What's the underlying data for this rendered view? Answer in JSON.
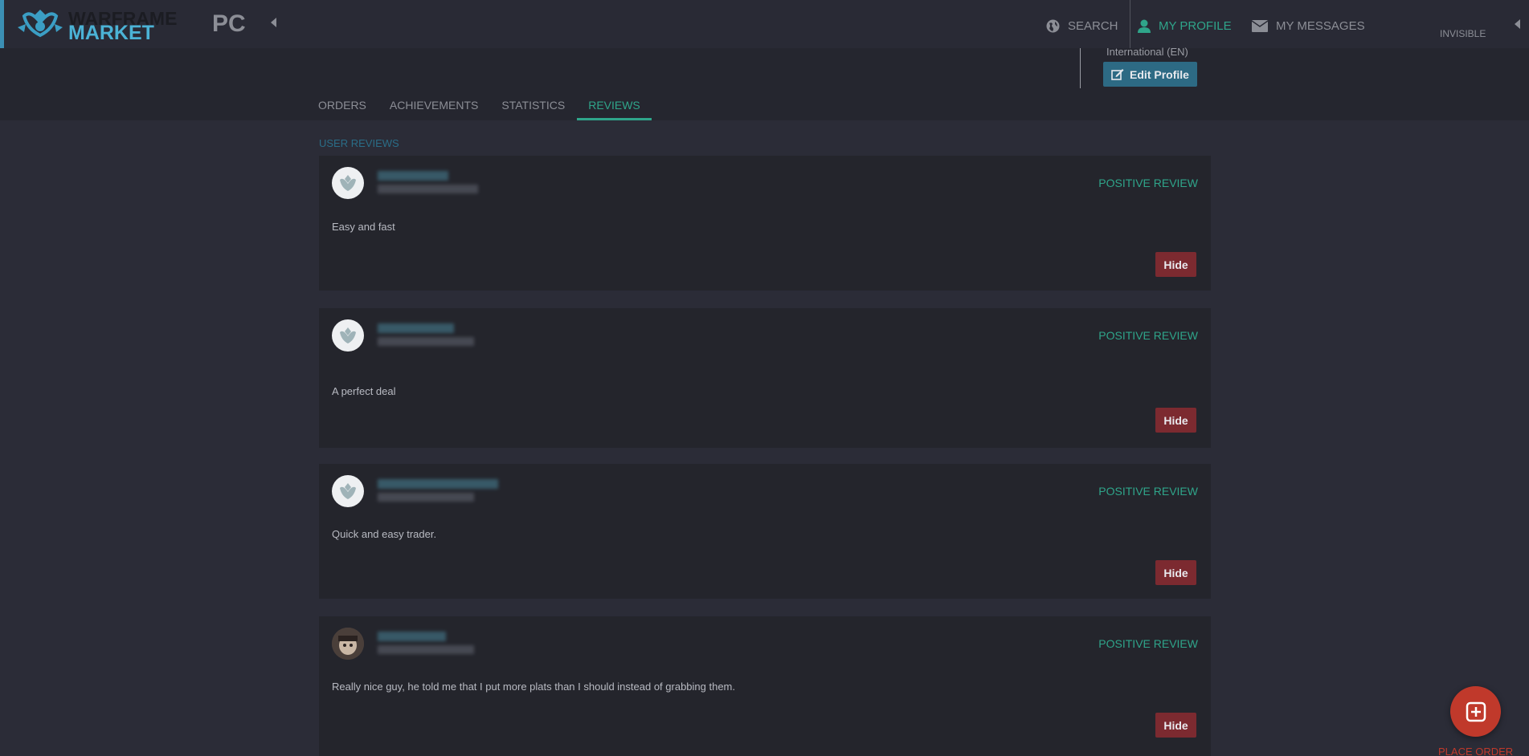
{
  "nav": {
    "logo_line1": "WARFRAME",
    "logo_line2": "MARKET",
    "platform": "PC",
    "search_label": "SEARCH",
    "profile_label": "MY PROFILE",
    "messages_label": "MY MESSAGES",
    "status_label": "INVISIBLE"
  },
  "profile": {
    "language": "International (EN)",
    "edit_button": "Edit Profile"
  },
  "tabs": [
    {
      "label": "ORDERS",
      "active": false
    },
    {
      "label": "ACHIEVEMENTS",
      "active": false
    },
    {
      "label": "STATISTICS",
      "active": false
    },
    {
      "label": "REVIEWS",
      "active": true
    }
  ],
  "section_title": "USER REVIEWS",
  "reviews": [
    {
      "type": "POSITIVE REVIEW",
      "text": "Easy and fast",
      "hide_label": "Hide"
    },
    {
      "type": "POSITIVE REVIEW",
      "text": "A perfect deal",
      "hide_label": "Hide"
    },
    {
      "type": "POSITIVE REVIEW",
      "text": "Quick and easy trader.",
      "hide_label": "Hide"
    },
    {
      "type": "POSITIVE REVIEW",
      "text": "Really nice guy, he told me that I put more plats than I should instead of grabbing them.",
      "hide_label": "Hide"
    }
  ],
  "place_order_label": "PLACE ORDER",
  "colors": {
    "accent_teal": "#2fa58a",
    "accent_blue": "#4bb3d6",
    "hide_red": "#7c2a30",
    "fab_red": "#c0392b"
  }
}
